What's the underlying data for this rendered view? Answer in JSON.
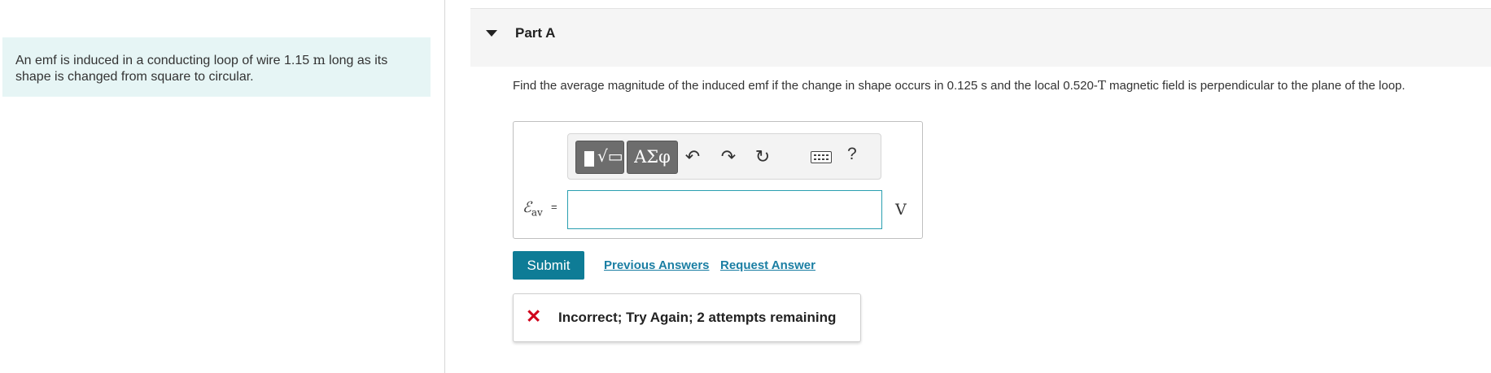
{
  "problem": {
    "intro_before": "An emf is induced in a conducting loop of wire 1.15 ",
    "intro_unit": "m",
    "intro_after": " long as its shape is changed from square to circular."
  },
  "part": {
    "title": "Part A",
    "question_before": "Find the average magnitude of the induced emf if the change in shape occurs in 0.125 s and the local 0.520-",
    "question_unit": "T",
    "question_after": " magnetic field is perpendicular to the plane of the loop."
  },
  "answer": {
    "symbol": "ℰ",
    "subscript": "av",
    "equals": "=",
    "value": "",
    "unit": "V"
  },
  "toolbar": {
    "templates_icon": "templates-icon",
    "symbols_label": "ΑΣφ",
    "undo_icon": "undo-icon",
    "redo_icon": "redo-icon",
    "reset_icon": "reset-icon",
    "keyboard_icon": "keyboard-icon",
    "help_label": "?"
  },
  "actions": {
    "submit_label": "Submit",
    "previous_answers": "Previous Answers",
    "request_answer": "Request Answer"
  },
  "feedback": {
    "icon": "x-icon",
    "text": "Incorrect; Try Again; 2 attempts remaining"
  },
  "colors": {
    "accent": "#0e7c96",
    "link": "#1a7ea3",
    "intro_bg": "#e6f5f5",
    "error": "#d0021b"
  }
}
